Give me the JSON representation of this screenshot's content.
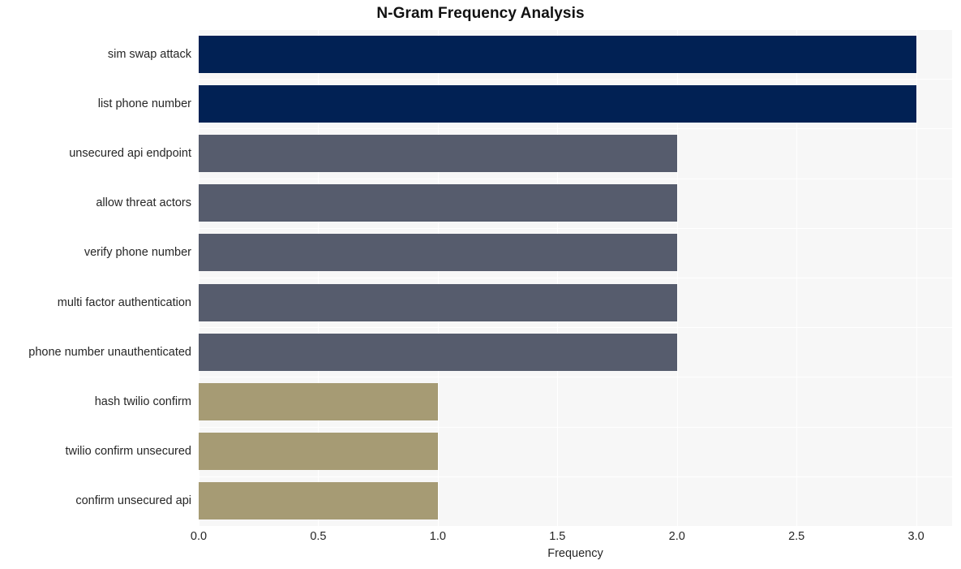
{
  "chart_data": {
    "type": "bar",
    "orientation": "horizontal",
    "title": "N-Gram Frequency Analysis",
    "xlabel": "Frequency",
    "ylabel": "",
    "xlim": [
      0,
      3.1505
    ],
    "xticks": [
      "0.0",
      "0.5",
      "1.0",
      "1.5",
      "2.0",
      "2.5",
      "3.0"
    ],
    "xtick_values": [
      0,
      0.5,
      1,
      1.5,
      2,
      2.5,
      3
    ],
    "grid": true,
    "legend": "none",
    "categories": [
      "sim swap attack",
      "list phone number",
      "unsecured api endpoint",
      "allow threat actors",
      "verify phone number",
      "multi factor authentication",
      "phone number unauthenticated",
      "hash twilio confirm",
      "twilio confirm unsecured",
      "confirm unsecured api"
    ],
    "values": [
      3,
      3,
      2,
      2,
      2,
      2,
      2,
      1,
      1,
      1
    ],
    "bar_colors": [
      "#012154",
      "#012154",
      "#565c6d",
      "#565c6d",
      "#565c6d",
      "#565c6d",
      "#565c6d",
      "#a69b74",
      "#a69b74",
      "#a69b74"
    ],
    "plot_background": "#f7f7f7",
    "gridline_color": "#ffffff",
    "figure_background": "#ffffff"
  }
}
